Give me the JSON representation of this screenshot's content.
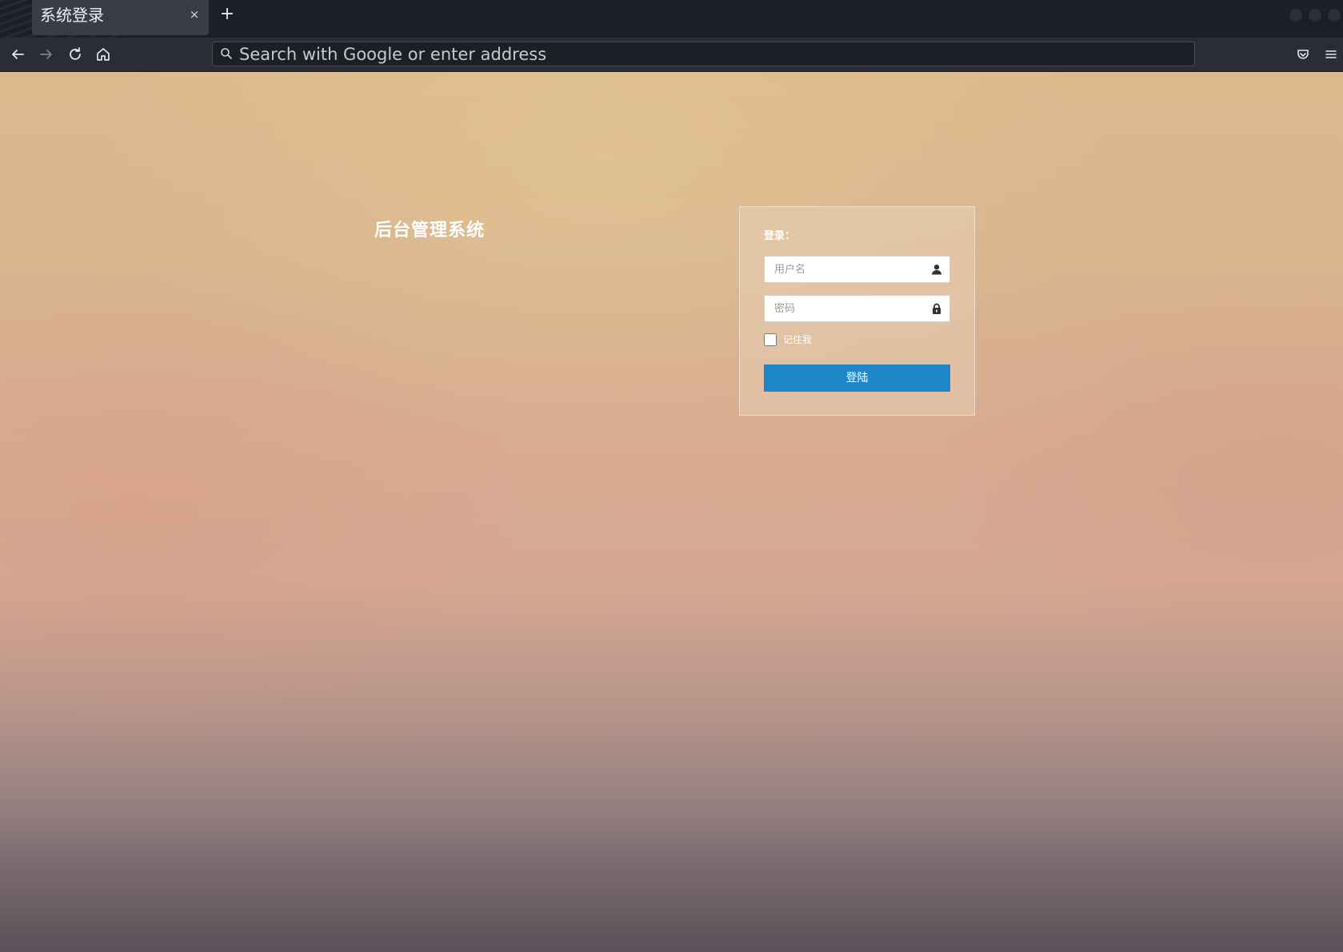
{
  "browser": {
    "tab": {
      "title": "系统登录",
      "close_glyph": "×"
    },
    "new_tab_glyph": "+",
    "nav": {
      "back_icon": "back-arrow-icon",
      "forward_icon": "forward-arrow-icon",
      "reload_icon": "reload-icon",
      "home_icon": "home-icon"
    },
    "urlbar": {
      "placeholder": "Search with Google or enter address",
      "value": ""
    },
    "toolbar_icons": [
      "pocket-icon",
      "menu-icon"
    ]
  },
  "page": {
    "system_title": "后台管理系统",
    "login": {
      "heading": "登录：",
      "username_placeholder": "用户名",
      "password_placeholder": "密码",
      "remember_label": "记住我",
      "submit_label": "登陆"
    }
  },
  "colors": {
    "button": "#1e87c9",
    "tab_active": "#3a3d47",
    "chrome": "#1c1f27"
  }
}
